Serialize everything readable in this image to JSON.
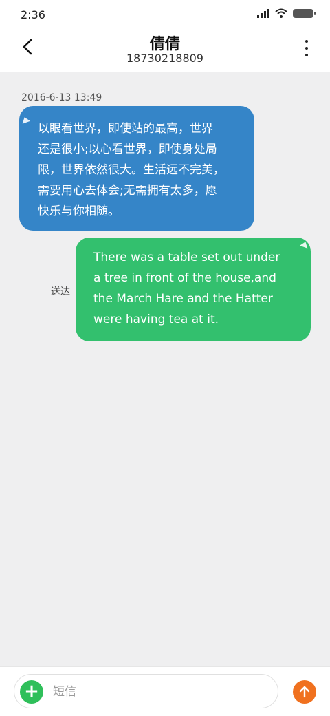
{
  "status_bar": {
    "time": "2:36"
  },
  "header": {
    "title": "倩倩",
    "subtitle": "18730218809"
  },
  "conversation": {
    "timestamp": "2016-6-13 13:49",
    "incoming_lines": [
      "以眼看世界，即使站的最高，世界",
      "还是很小;以心看世界，即使身处局",
      "限，世界依然很大。生活远不完美，",
      "需要用心去体会;无需拥有太多，愿",
      "快乐与你相随。"
    ],
    "outgoing_lines": [
      "There was a table set out under",
      "a tree in front of the house,and",
      "the March Hare and the Hatter",
      "were having tea at it."
    ],
    "outgoing_status": "送达"
  },
  "composer": {
    "placeholder": "短信"
  },
  "colors": {
    "incoming_bubble": "#3585c8",
    "outgoing_bubble": "#33c06e",
    "add_button": "#2fbf5a",
    "send_button": "#f0711f",
    "background": "#efeff0"
  }
}
